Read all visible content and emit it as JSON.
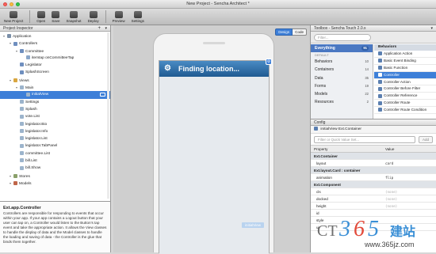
{
  "window": {
    "title": "New Project - Sencha Architect *"
  },
  "toolbar": {
    "buttons": [
      {
        "label": "New Project",
        "icon": "new-project-icon"
      },
      {
        "label": "Open",
        "icon": "open-folder-icon"
      },
      {
        "label": "Save",
        "icon": "save-icon"
      },
      {
        "label": "Snapshot",
        "icon": "camera-icon"
      },
      {
        "label": "Deploy",
        "icon": "deploy-icon"
      },
      {
        "label": "Preview",
        "icon": "preview-icon"
      },
      {
        "label": "Settings",
        "icon": "gear-icon"
      }
    ]
  },
  "inspector": {
    "title": "Project Inspector",
    "items": [
      {
        "label": "Application",
        "depth": 0,
        "color": "#7a8fa8"
      },
      {
        "label": "Controllers",
        "depth": 1,
        "color": "#6f8fbf"
      },
      {
        "label": "Committee",
        "depth": 2,
        "color": "#6f8fbf"
      },
      {
        "label": "itemtap  onCommitteeTap",
        "depth": 3,
        "color": "#8aa6c9"
      },
      {
        "label": "Legislator",
        "depth": 2,
        "color": "#6f8fbf"
      },
      {
        "label": "SplashScreen",
        "depth": 2,
        "color": "#6f8fbf"
      },
      {
        "label": "Views",
        "depth": 1,
        "color": "#d9a640"
      },
      {
        "label": "Main",
        "depth": 2,
        "color": "#9cb4cc"
      },
      {
        "label": "initialView",
        "depth": 3,
        "color": "#9cb4cc",
        "selected": true
      },
      {
        "label": "Settings",
        "depth": 2,
        "color": "#9cb4cc"
      },
      {
        "label": "Splash",
        "depth": 2,
        "color": "#9cb4cc"
      },
      {
        "label": "vote.List",
        "depth": 2,
        "color": "#9cb4cc"
      },
      {
        "label": "legislator.Bio",
        "depth": 2,
        "color": "#9cb4cc"
      },
      {
        "label": "legislator.Info",
        "depth": 2,
        "color": "#9cb4cc"
      },
      {
        "label": "legislator.List",
        "depth": 2,
        "color": "#9cb4cc"
      },
      {
        "label": "legislator.TabPanel",
        "depth": 2,
        "color": "#9cb4cc"
      },
      {
        "label": "committee.List",
        "depth": 2,
        "color": "#9cb4cc"
      },
      {
        "label": "bill.List",
        "depth": 2,
        "color": "#9cb4cc"
      },
      {
        "label": "bill.Show",
        "depth": 2,
        "color": "#9cb4cc"
      },
      {
        "label": "Stores",
        "depth": 1,
        "color": "#8aa06a"
      },
      {
        "label": "Models",
        "depth": 1,
        "color": "#c0664a"
      }
    ]
  },
  "help": {
    "title": "Ext.app.Controller",
    "body": "Controllers are responsible for responding to events that occur within your app. If your app contains a Logout button that your user can tap on, a Controller would listen to the Button's tap event and take the appropriate action. It allows the View classes to handle the display of data and the Model classes to handle the loading and saving of data - the Controller is the glue that binds them together."
  },
  "canvas": {
    "tabs": [
      "Design",
      "Code"
    ],
    "active_tab": "Design",
    "nav_title": "Finding location...",
    "bottom_label": "initialView"
  },
  "toolbox": {
    "title": "Toolbox - Sencha Touch 2.0.x",
    "filter_placeholder": "Filter...",
    "everything": {
      "label": "Everything",
      "count": "91"
    },
    "default_heading": "DEFAULT",
    "categories": [
      {
        "label": "Behaviors",
        "count": "10"
      },
      {
        "label": "Containers",
        "count": "14"
      },
      {
        "label": "Data",
        "count": "35"
      },
      {
        "label": "Forms",
        "count": "19"
      },
      {
        "label": "Models",
        "count": "22"
      },
      {
        "label": "Resources",
        "count": "2"
      }
    ],
    "right_header": "Behaviors",
    "items": [
      {
        "label": "Application Action",
        "color": "#5b7fb0"
      },
      {
        "label": "Basic Event Binding",
        "color": "#5b7fb0"
      },
      {
        "label": "Basic Function",
        "color": "#5b7fb0"
      },
      {
        "label": "Controller",
        "color": "#5b7fb0",
        "selected": true
      },
      {
        "label": "Controller Action",
        "color": "#5b7fb0"
      },
      {
        "label": "Controller Before Filter",
        "color": "#5b7fb0"
      },
      {
        "label": "Controller Reference",
        "color": "#5b7fb0"
      },
      {
        "label": "Controller Route",
        "color": "#5b7fb0"
      },
      {
        "label": "Controller Route Condition",
        "color": "#5b7fb0"
      }
    ]
  },
  "config": {
    "title": "Config",
    "component": "initialView  Ext.Container",
    "filter_placeholder": "Filter or Quick Value Set...",
    "add_label": "Add",
    "col_property": "Property",
    "col_value": "Value",
    "rows": [
      {
        "type": "section",
        "label": "Ext.Container"
      },
      {
        "type": "prop",
        "label": "layout",
        "value": "card"
      },
      {
        "type": "section",
        "label": "Ext.layout.Card : container"
      },
      {
        "type": "prop",
        "label": "animation",
        "value": "flip"
      },
      {
        "type": "section",
        "label": "Ext.Component"
      },
      {
        "type": "prop",
        "label": "cls",
        "value": "(none)"
      },
      {
        "type": "prop",
        "label": "docked",
        "value": "(none)"
      },
      {
        "type": "prop",
        "label": "height",
        "value": "(none)"
      },
      {
        "type": "prop",
        "label": "id",
        "value": ""
      },
      {
        "type": "prop",
        "label": "style",
        "value": ""
      },
      {
        "type": "prop",
        "label": "ui",
        "value": ""
      }
    ]
  },
  "colors": {
    "selection": "#3d7fd8",
    "nav_blue": "#2a6aa8",
    "toolbox_selected": "#4a78c2"
  }
}
